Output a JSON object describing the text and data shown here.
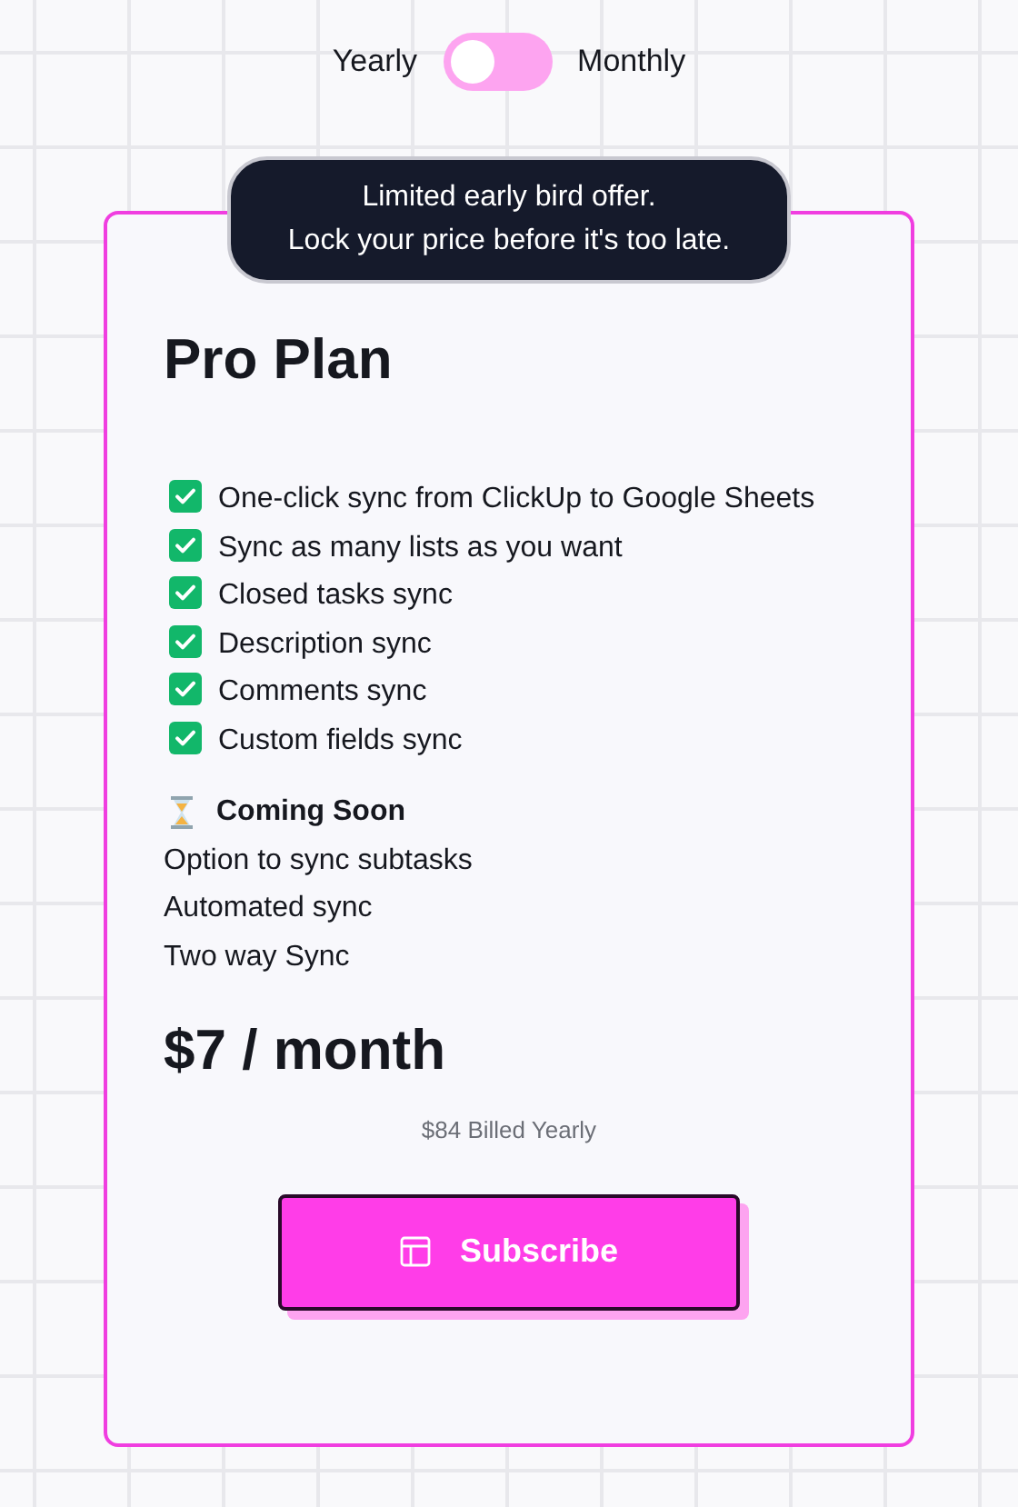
{
  "billing_toggle": {
    "left_label": "Yearly",
    "right_label": "Monthly",
    "on": false
  },
  "badge": {
    "lines": [
      "Limited early bird offer.",
      "Lock your price before it's too late."
    ]
  },
  "plan": {
    "title": "Pro Plan",
    "features": [
      {
        "kind": "check",
        "text": "One-click sync from ClickUp to Google Sheets"
      },
      {
        "kind": "check",
        "text": "Sync as many lists as you want"
      },
      {
        "kind": "check",
        "text": "Closed tasks sync"
      },
      {
        "kind": "check",
        "text": "Description sync"
      },
      {
        "kind": "check",
        "text": "Comments sync"
      },
      {
        "kind": "check",
        "text": "Custom fields sync"
      }
    ],
    "coming_soon": {
      "heading": "Coming Soon",
      "items": [
        "Option to sync subtasks",
        "Automated sync",
        "Two way Sync"
      ]
    },
    "price": "$7 / month",
    "billed_note": "$84 Billed Yearly",
    "button": "Subscribe"
  }
}
